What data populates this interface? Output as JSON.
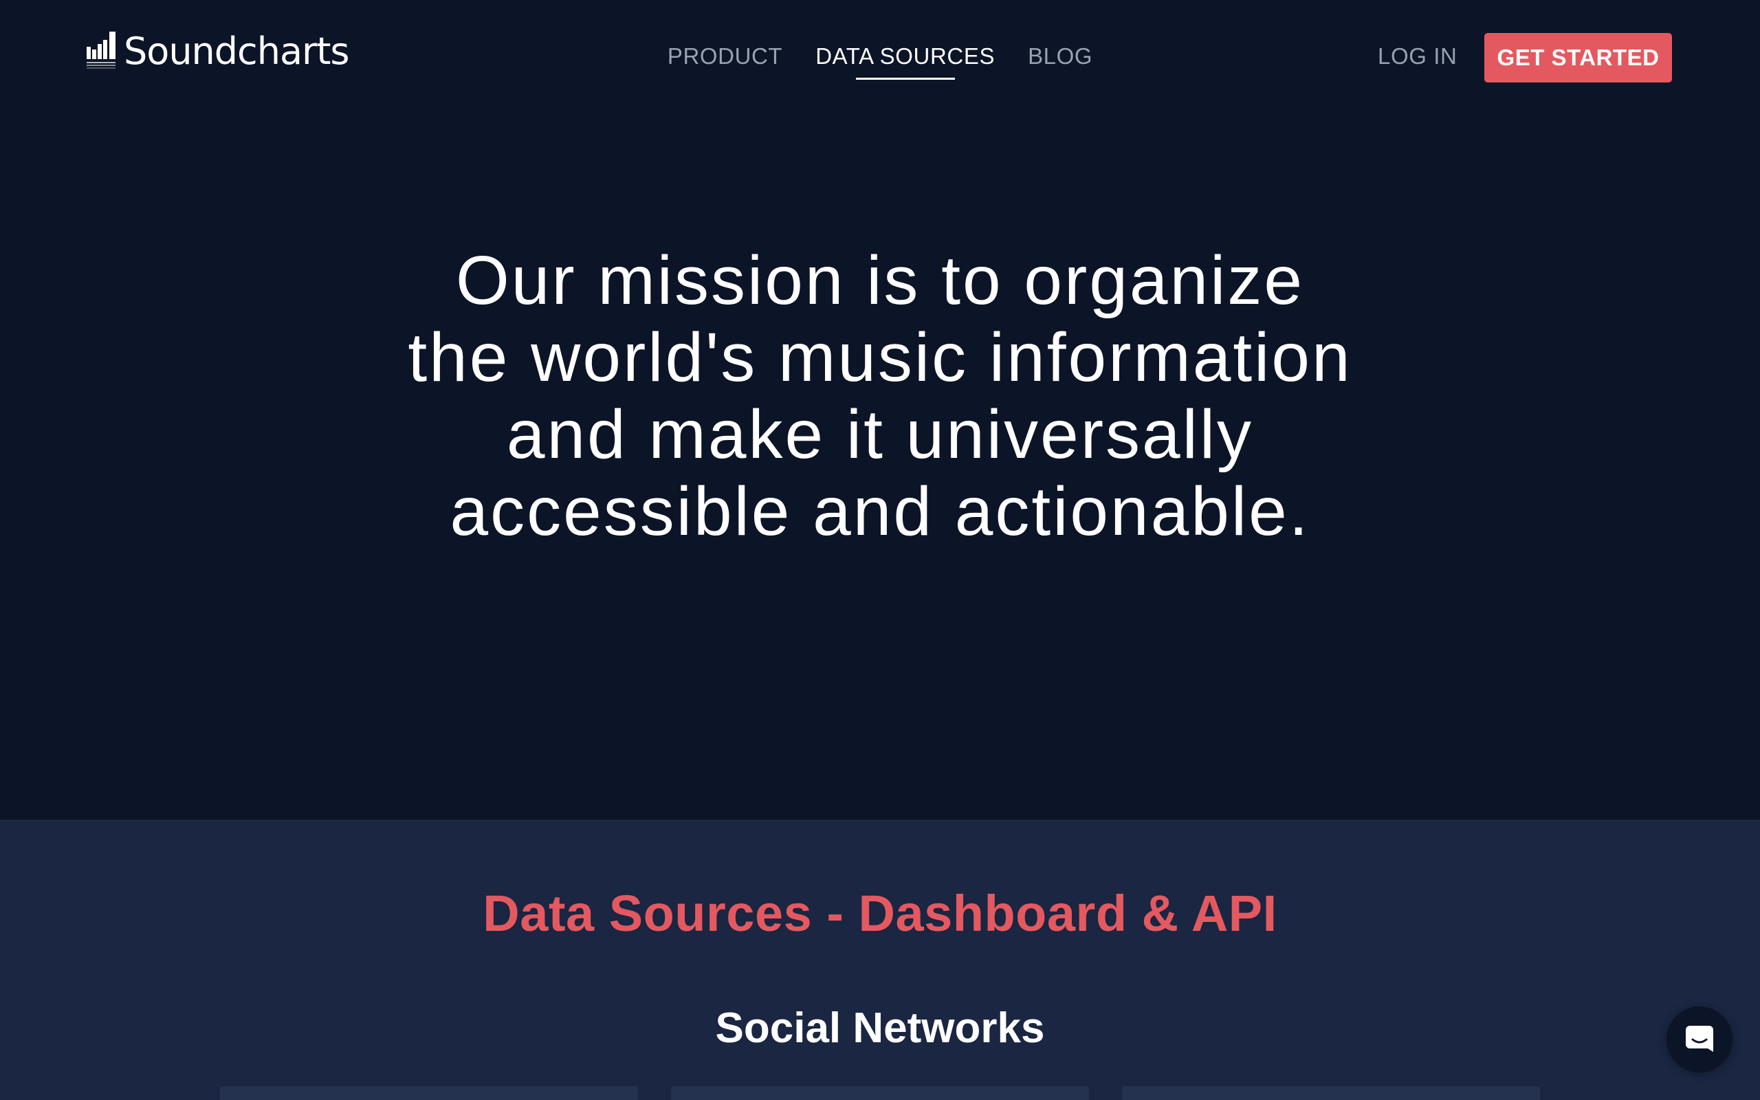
{
  "brand": {
    "logo_icon": "soundcharts-bars-logo-icon",
    "name": "Soundcharts"
  },
  "nav": {
    "items": [
      {
        "label": "PRODUCT",
        "active": false
      },
      {
        "label": "DATA SOURCES",
        "active": true
      },
      {
        "label": "BLOG",
        "active": false
      }
    ],
    "login_label": "LOG IN",
    "cta_label": "GET STARTED"
  },
  "hero": {
    "lines": [
      "Our mission is to organize",
      "the world's music information",
      "and make it universally",
      "accessible and actionable."
    ]
  },
  "sources": {
    "title": "Data Sources - Dashboard & API",
    "subtitle": "Social Networks"
  },
  "chat": {
    "icon": "chat-bubble-icon"
  },
  "colors": {
    "background": "#0c1427",
    "section_background": "#1a2642",
    "accent": "#e4595f",
    "nav_inactive": "#9aa1b2",
    "text": "#ffffff"
  }
}
